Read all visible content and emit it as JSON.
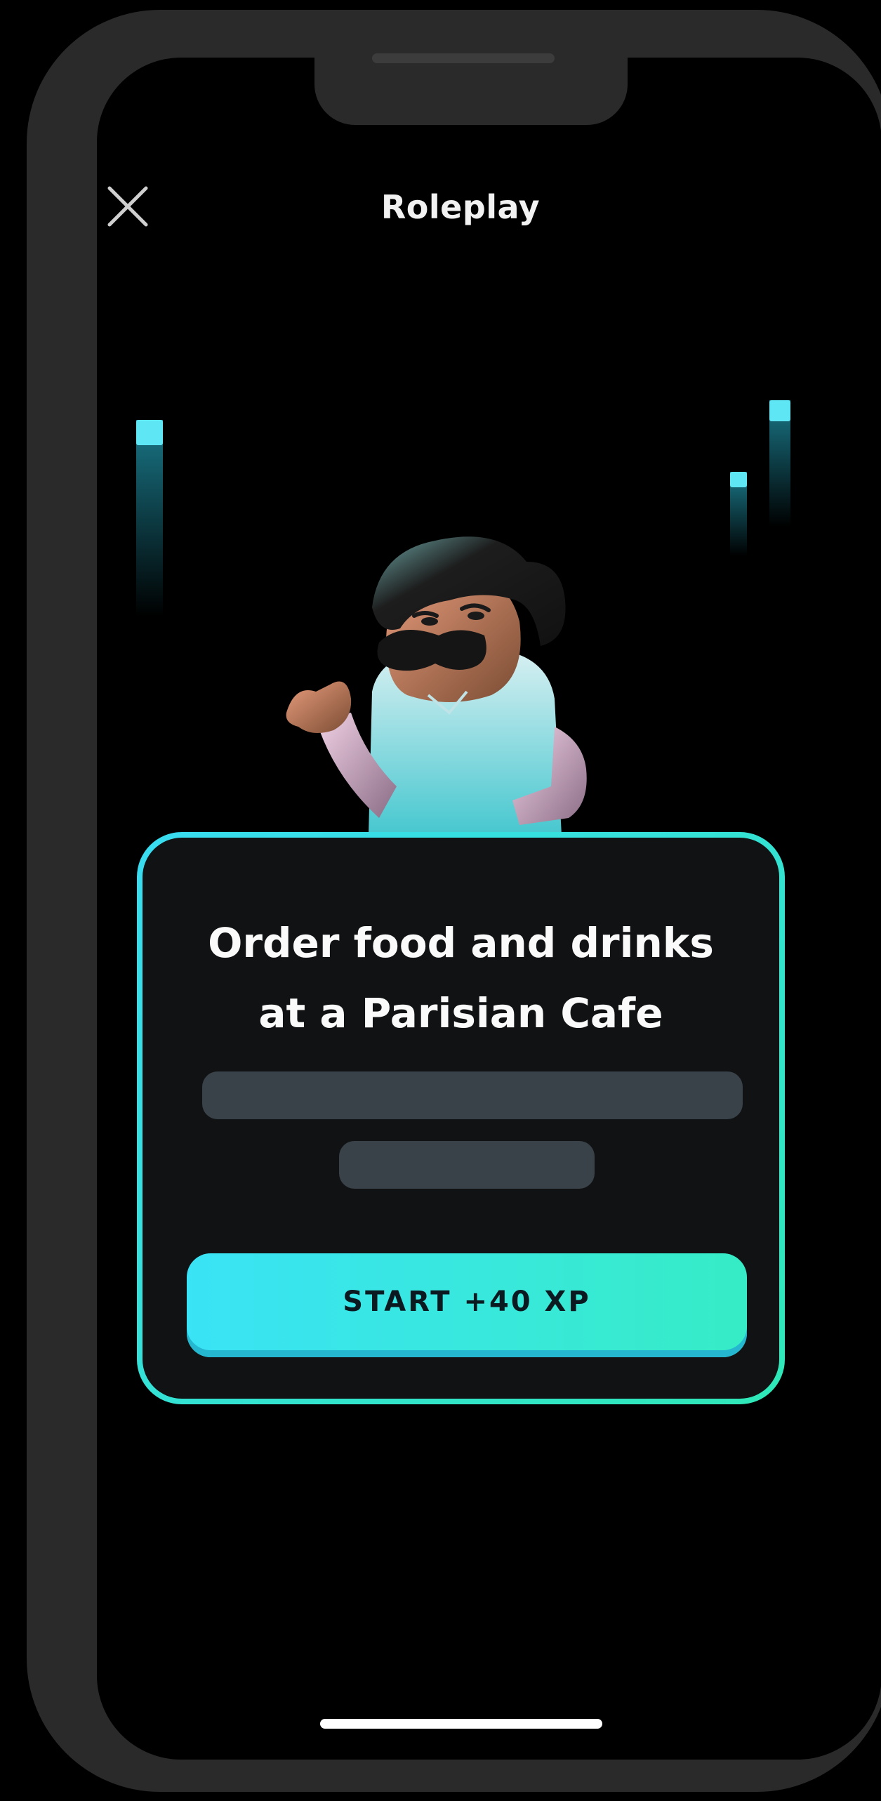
{
  "header": {
    "title": "Roleplay",
    "close_icon": "close-icon"
  },
  "lesson_card": {
    "title_line_1": "Order food and drinks",
    "title_line_2": "at a Parisian Cafe",
    "start_button_label": "START +40 XP"
  },
  "character": {
    "icon": "cafe-waiter-character"
  },
  "colors": {
    "background": "#000000",
    "card_border_start": "#39dcf0",
    "card_border_end": "#2fe8b8",
    "button_start": "#3ae3f5",
    "button_end": "#36ecc6",
    "skeleton": "#3a4249"
  }
}
